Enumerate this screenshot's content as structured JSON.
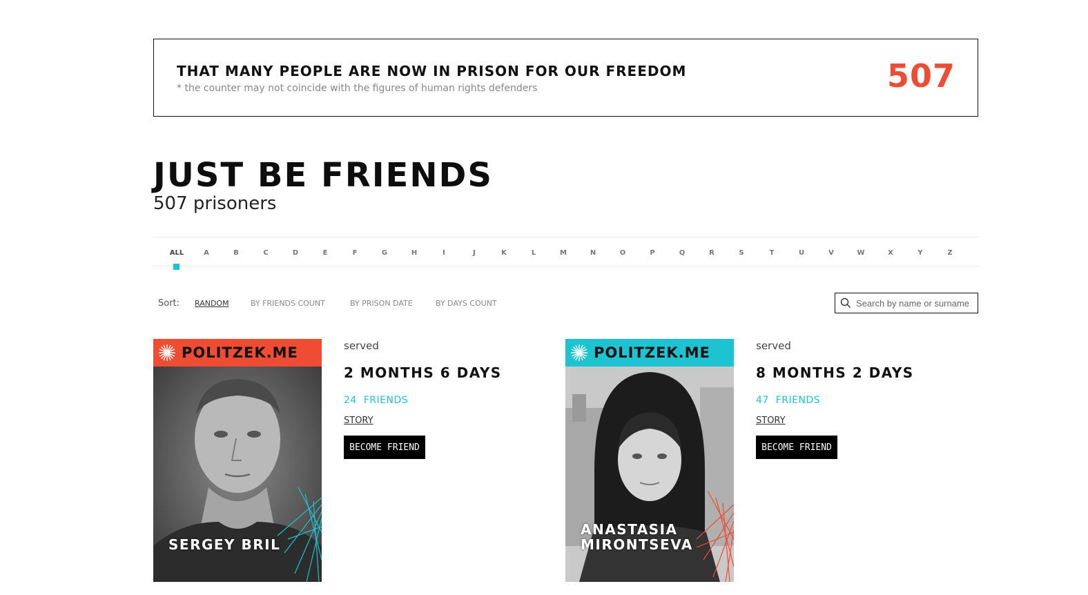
{
  "banner": {
    "title": "THAT MANY PEOPLE ARE NOW IN PRISON FOR OUR FREEDOM",
    "note": "* the counter may not coincide with the figures of human rights defenders",
    "count": "507"
  },
  "heading": {
    "title": "JUST BE FRIENDS",
    "subtitle": "507 prisoners"
  },
  "alphabet": {
    "letters": [
      "ALL",
      "A",
      "B",
      "C",
      "D",
      "E",
      "F",
      "G",
      "H",
      "I",
      "J",
      "K",
      "L",
      "M",
      "N",
      "O",
      "P",
      "Q",
      "R",
      "S",
      "T",
      "U",
      "V",
      "W",
      "X",
      "Y",
      "Z"
    ],
    "active": "ALL"
  },
  "sort": {
    "label": "Sort:",
    "options": [
      "RANDOM",
      "BY FRIENDS COUNT",
      "BY PRISON DATE",
      "BY DAYS COUNT"
    ],
    "active": "RANDOM"
  },
  "search": {
    "placeholder": "Search by name or surname",
    "value": ""
  },
  "cards": [
    {
      "brand": "POLITZEK.ME",
      "name_lines": [
        "SERGEY BRIL"
      ],
      "header_color": "#ee4c33",
      "accent_color": "#1ec3d2",
      "served_label": "served",
      "served_value": "2 MONTHS 6 DAYS",
      "friends_count": "24",
      "friends_label": "FRIENDS",
      "story_label": "STORY",
      "button_label": "BECOME FRIEND"
    },
    {
      "brand": "POLITZEK.ME",
      "name_lines": [
        "ANASTASIA",
        "MIRONTSEVA"
      ],
      "header_color": "#1ec3d2",
      "accent_color": "#ee4c33",
      "served_label": "served",
      "served_value": "8 MONTHS 2 DAYS",
      "friends_count": "47",
      "friends_label": "FRIENDS",
      "story_label": "STORY",
      "button_label": "BECOME FRIEND"
    }
  ],
  "colors": {
    "accent_red": "#ee4c33",
    "accent_cyan": "#1ec3d2"
  }
}
